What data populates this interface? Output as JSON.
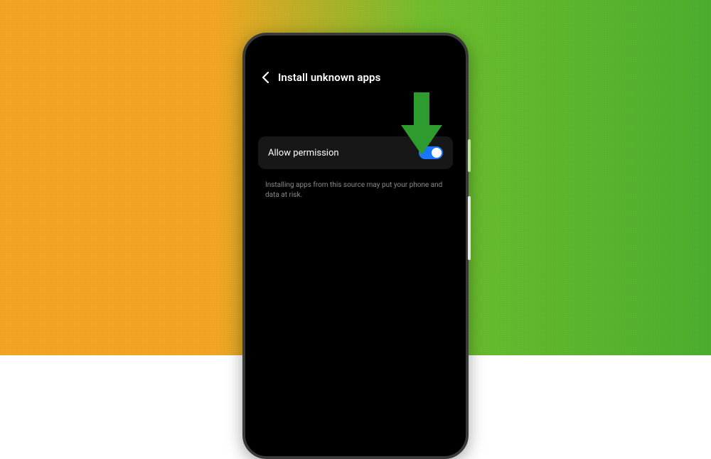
{
  "header": {
    "title": "Install unknown apps"
  },
  "permission": {
    "label": "Allow permission",
    "enabled": true
  },
  "hint": "Installing apps from this source may put your phone and data at risk.",
  "annotation": {
    "arrow_color": "#2e9b2e"
  }
}
